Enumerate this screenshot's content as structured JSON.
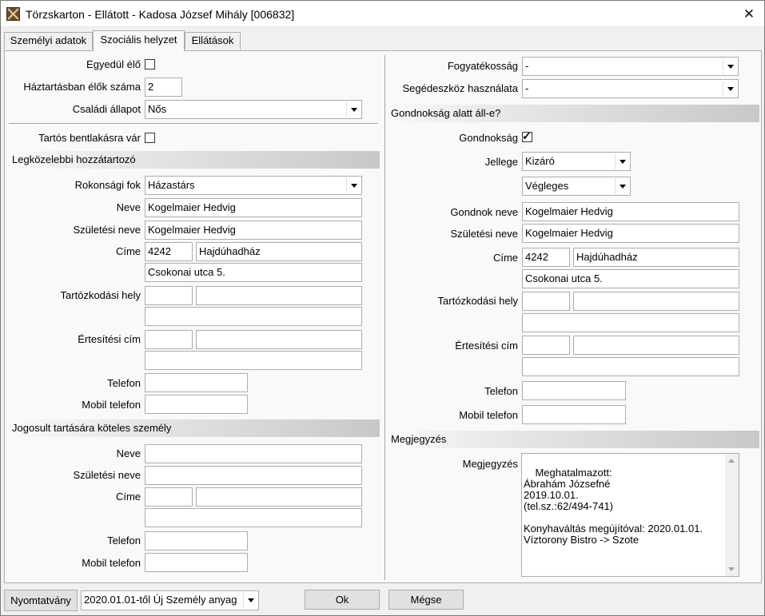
{
  "window": {
    "title": "Törzskarton - Ellátott - Kadosa József Mihály [006832]"
  },
  "tabs": [
    {
      "label": "Személyi adatok"
    },
    {
      "label": "Szociális helyzet"
    },
    {
      "label": "Ellátások"
    }
  ],
  "left": {
    "alone_label": "Egyedül élő",
    "household_label": "Háztartásban élők száma",
    "household_value": "2",
    "marital_label": "Családi állapot",
    "marital_value": "Nős",
    "waiting_label": "Tartós bentlakásra vár",
    "relative": {
      "section": "Legközelebbi hozzátartozó",
      "relation_label": "Rokonsági fok",
      "relation_value": "Házastárs",
      "name_label": "Neve",
      "name_value": "Kogelmaier Hedvig",
      "birthname_label": "Születési neve",
      "birthname_value": "Kogelmaier Hedvig",
      "address_label": "Címe",
      "zip": "4242",
      "city": "Hajdúhadház",
      "street": "Csokonai utca 5.",
      "residence_label": "Tartózkodási hely",
      "notify_label": "Értesítési cím",
      "phone_label": "Telefon",
      "mobile_label": "Mobil telefon"
    },
    "obligor": {
      "section": "Jogosult tartására köteles személy",
      "name_label": "Neve",
      "birthname_label": "Születési neve",
      "address_label": "Címe",
      "phone_label": "Telefon",
      "mobile_label": "Mobil telefon"
    }
  },
  "right": {
    "disability_label": "Fogyatékosság",
    "disability_value": "-",
    "aid_label": "Segédeszköz használata",
    "aid_value": "-",
    "guardian": {
      "section": "Gondnokság alatt áll-e?",
      "guardianship_label": "Gondnokság",
      "type_label": "Jellege",
      "type_value": "Kizáró",
      "duration_value": "Végleges",
      "guardian_name_label": "Gondnok neve",
      "guardian_name_value": "Kogelmaier Hedvig",
      "birthname_label": "Születési neve",
      "birthname_value": "Kogelmaier Hedvig",
      "address_label": "Címe",
      "zip": "4242",
      "city": "Hajdúhadház",
      "street": "Csokonai utca 5.",
      "residence_label": "Tartózkodási hely",
      "notify_label": "Értesítési cím",
      "phone_label": "Telefon",
      "mobile_label": "Mobil telefon"
    },
    "notes": {
      "section": "Megjegyzés",
      "label": "Megjegyzés",
      "value": "Meghatalmazott:\nÁbrahám Józsefné\n2019.10.01.\n(tel.sz.:62/494-741)\n\nKonyhaváltás megújítóval: 2020.01.01.\nVíztorony Bistro -> Szote"
    }
  },
  "footer": {
    "print_label": "Nyomtatvány",
    "print_template": "2020.01.01-től Új Személy anyag",
    "ok_label": "Ok",
    "cancel_label": "Mégse"
  },
  "colors": {
    "section_header": "#c8c8c8",
    "window_bg": "#f0f0f0",
    "panel_bg": "#f9f9f9"
  }
}
